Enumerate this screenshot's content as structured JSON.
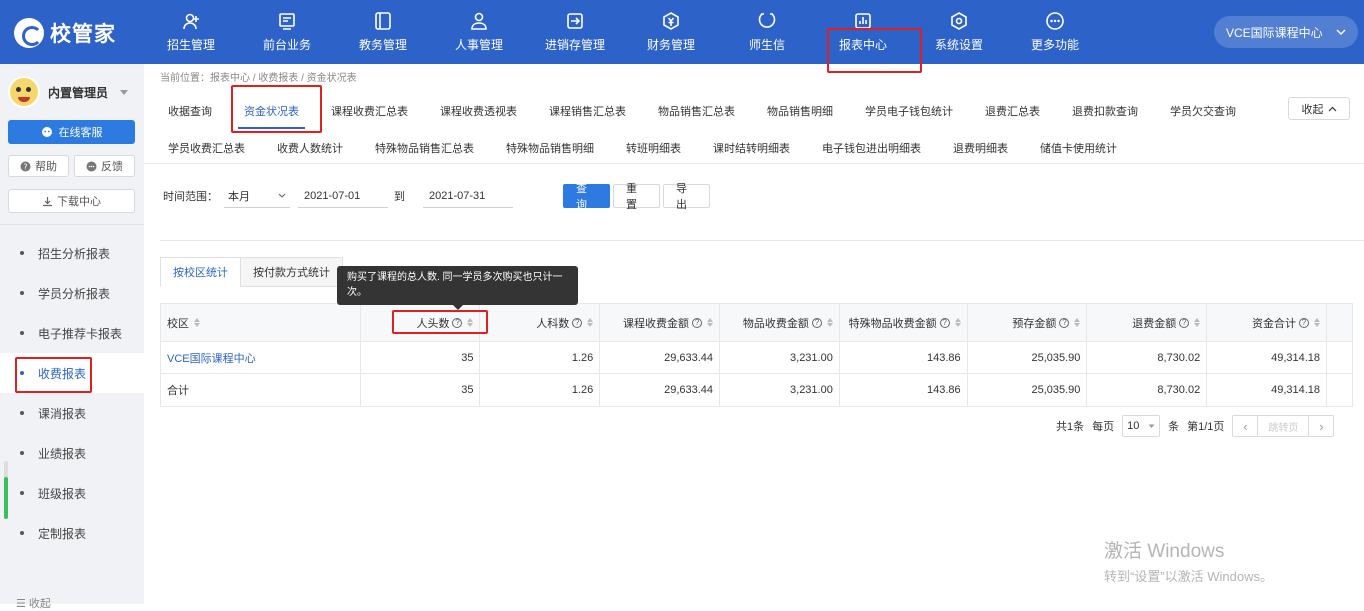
{
  "app": {
    "logo_text": "校管家"
  },
  "nav": [
    {
      "label": "招生管理",
      "icon": "user-add-icon"
    },
    {
      "label": "前台业务",
      "icon": "monitor-icon"
    },
    {
      "label": "教务管理",
      "icon": "book-icon"
    },
    {
      "label": "人事管理",
      "icon": "person-icon"
    },
    {
      "label": "进销存管理",
      "icon": "box-arrow-icon"
    },
    {
      "label": "财务管理",
      "icon": "yen-icon"
    },
    {
      "label": "师生信",
      "icon": "chat-icon"
    },
    {
      "label": "报表中心",
      "icon": "chart-icon"
    },
    {
      "label": "系统设置",
      "icon": "gear-icon"
    },
    {
      "label": "更多功能",
      "icon": "more-icon"
    }
  ],
  "school_selector": "VCE国际课程中心",
  "sidebar": {
    "user_name": "内置管理员",
    "online_service": "在线客服",
    "help": "帮助",
    "feedback": "反馈",
    "download_center": "下载中心",
    "items": [
      {
        "label": "招生分析报表"
      },
      {
        "label": "学员分析报表"
      },
      {
        "label": "电子推荐卡报表"
      },
      {
        "label": "收费报表"
      },
      {
        "label": "课消报表"
      },
      {
        "label": "业绩报表"
      },
      {
        "label": "班级报表"
      },
      {
        "label": "定制报表"
      }
    ],
    "active_index": 3,
    "collapse": "收起"
  },
  "breadcrumb": "当前位置：报表中心 / 收费报表 / 资金状况表",
  "report_tabs": {
    "row1": [
      "收据查询",
      "资金状况表",
      "课程收费汇总表",
      "课程收费透视表",
      "课程销售汇总表",
      "物品销售汇总表",
      "物品销售明细",
      "学员电子钱包统计",
      "退费汇总表",
      "退费扣款查询",
      "学员欠交查询"
    ],
    "row2": [
      "学员收费汇总表",
      "收费人数统计",
      "特殊物品销售汇总表",
      "特殊物品销售明细",
      "转班明细表",
      "课时结转明细表",
      "电子钱包进出明细表",
      "退费明细表",
      "储值卡使用统计"
    ],
    "active": "资金状况表",
    "collapse_label": "收起"
  },
  "filter": {
    "label": "时间范围：",
    "period": "本月",
    "start_date": "2021-07-01",
    "to": "到",
    "end_date": "2021-07-31",
    "query": "查询",
    "reset": "重置",
    "export": "导出"
  },
  "sub_tabs": [
    "按校区统计",
    "按付款方式统计"
  ],
  "tooltip": "购买了课程的总人数. 同一学员多次购买也只计一次。",
  "table": {
    "headers": [
      "校区",
      "人头数",
      "人科数",
      "课程收费金额",
      "物品收费金额",
      "特殊物品收费金额",
      "预存金额",
      "退费金额",
      "资金合计"
    ],
    "rows": [
      [
        "VCE国际课程中心",
        "35",
        "1.26",
        "29,633.44",
        "3,231.00",
        "143.86",
        "25,035.90",
        "8,730.02",
        "49,314.18"
      ],
      [
        "合计",
        "35",
        "1.26",
        "29,633.44",
        "3,231.00",
        "143.86",
        "25,035.90",
        "8,730.02",
        "49,314.18"
      ]
    ]
  },
  "pager": {
    "total": "共1条",
    "per_page_label": "每页",
    "per_page": "10",
    "unit": "条",
    "page_info": "第1/1页",
    "jump": "跳转页"
  },
  "watermark": {
    "line1": "激活 Windows",
    "line2": "转到“设置”以激活 Windows。"
  },
  "colors": {
    "primary": "#2d63c8",
    "button": "#2d7ae0",
    "highlight": "#e02020"
  }
}
